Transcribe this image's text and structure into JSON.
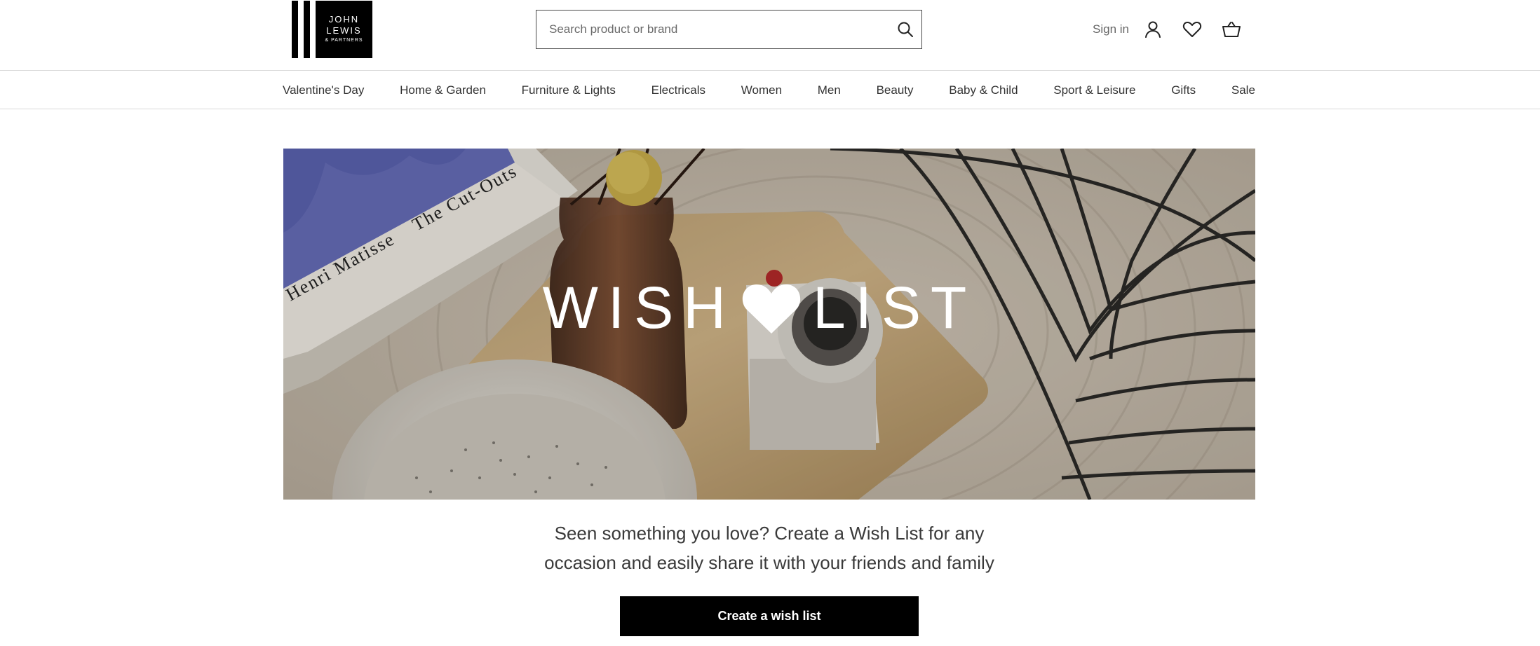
{
  "brand": {
    "logo_line1": "JOHN",
    "logo_line2": "LEWIS",
    "logo_line3": "& PARTNERS"
  },
  "search": {
    "placeholder": "Search product or brand",
    "icon": "search-icon"
  },
  "utilities": {
    "signin_label": "Sign in",
    "account_icon": "user-icon",
    "wishlist_icon": "heart-icon",
    "basket_icon": "basket-icon"
  },
  "nav": {
    "items": [
      "Valentine's Day",
      "Home & Garden",
      "Furniture & Lights",
      "Electricals",
      "Women",
      "Men",
      "Beauty",
      "Baby & Child",
      "Sport & Leisure",
      "Gifts",
      "Sale"
    ]
  },
  "hero": {
    "title_left": "WISH",
    "title_right": "LIST",
    "book_text_1": "Henri Matisse",
    "book_text_2": "The Cut-Outs"
  },
  "intro": {
    "line1": "Seen something you love? Create a Wish List for any",
    "line2": "occasion and easily share it with your friends and family"
  },
  "cta": {
    "label": "Create a wish list"
  },
  "colors": {
    "cta_background": "#000000",
    "text": "#333333",
    "divider": "#d9d9d9"
  }
}
